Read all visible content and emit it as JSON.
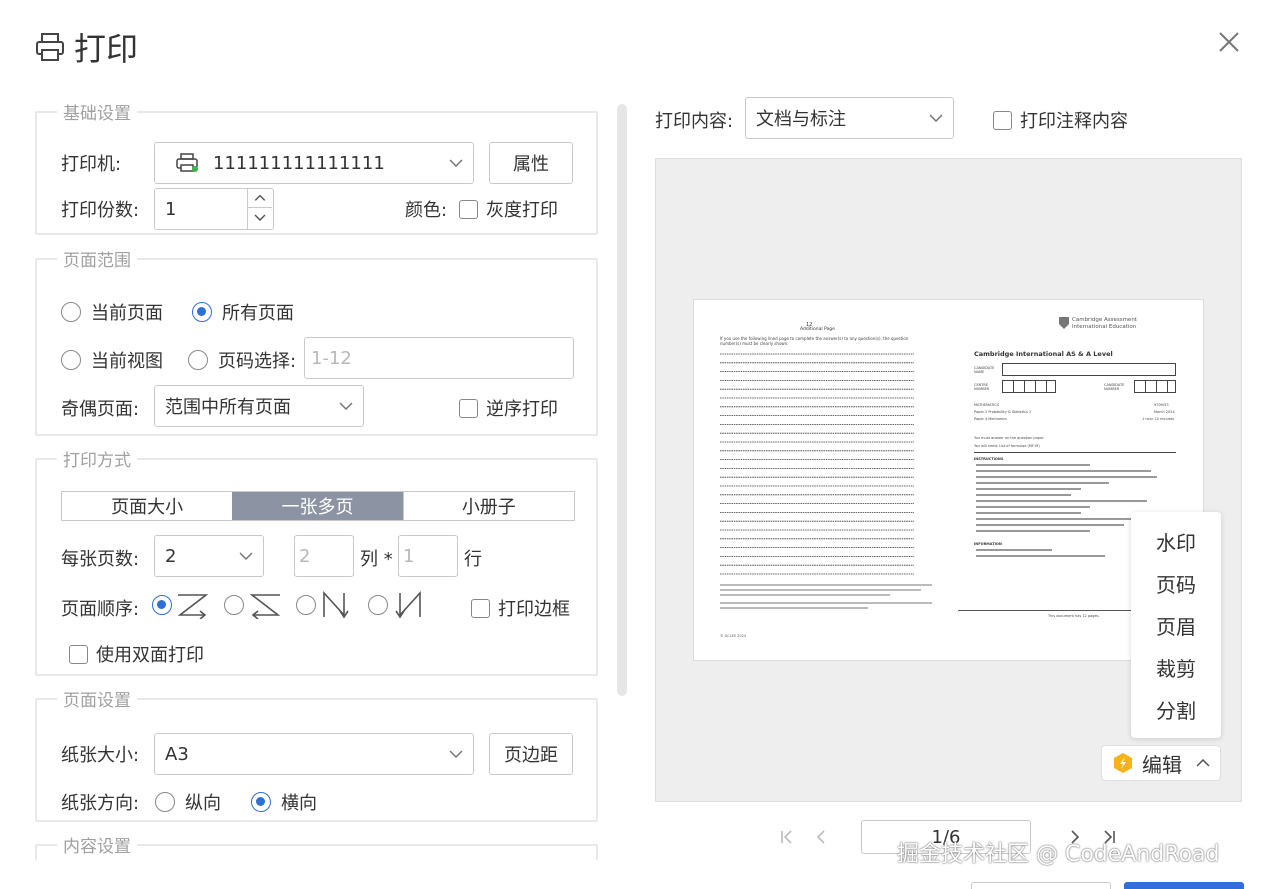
{
  "dialog": {
    "title": "打印"
  },
  "basic": {
    "legend": "基础设置",
    "printer_label": "打印机:",
    "printer_value": "111111111111111",
    "properties_btn": "属性",
    "copies_label": "打印份数:",
    "copies_value": "1",
    "color_label": "颜色:",
    "grayscale_label": "灰度打印"
  },
  "range": {
    "legend": "页面范围",
    "current_page": "当前页面",
    "all_pages": "所有页面",
    "current_view": "当前视图",
    "page_select": "页码选择:",
    "page_select_placeholder": "1-12",
    "odd_even_label": "奇偶页面:",
    "odd_even_value": "范围中所有页面",
    "reverse_label": "逆序打印"
  },
  "mode": {
    "legend": "打印方式",
    "tabs": [
      "页面大小",
      "一张多页",
      "小册子"
    ],
    "active_tab": 1,
    "per_sheet_label": "每张页数:",
    "per_sheet_value": "2",
    "cols_value": "2",
    "cols_unit": "列 *",
    "rows_value": "1",
    "rows_unit": "行",
    "order_label": "页面顺序:",
    "print_border": "打印边框",
    "duplex": "使用双面打印"
  },
  "page_setup": {
    "legend": "页面设置",
    "paper_label": "纸张大小:",
    "paper_value": "A3",
    "margins_btn": "页边距",
    "orientation_label": "纸张方向:",
    "portrait": "纵向",
    "landscape": "横向"
  },
  "content": {
    "legend": "内容设置"
  },
  "right": {
    "content_label": "打印内容:",
    "content_value": "文档与标注",
    "annotations_label": "打印注释内容"
  },
  "preview_page": {
    "left_page_no": "12",
    "left_heading": "Additional Page",
    "left_intro": "If you use the following lined page to complete the answer(s) to any question(s), the question number(s) must be clearly shown.",
    "left_footer": "© UCLES 2024",
    "logo_line1": "Cambridge Assessment",
    "logo_line2": "International Education",
    "right_title": "Cambridge International AS & A Level",
    "candidate_name": "CANDIDATE NAME",
    "centre_number": "CENTRE NUMBER",
    "candidate_number": "CANDIDATE NUMBER",
    "subject": "MATHEMATICS",
    "code": "9709/53",
    "paper": "Paper 5 Probability & Statistics 1",
    "session": "March 2024",
    "paper2": "Paper 4 Mechanics",
    "duration": "1 hour 15 minutes",
    "answer_on": "You must answer on the question paper.",
    "need": "You will need: List of formulae (MF19)",
    "instructions": "INSTRUCTIONS",
    "information": "INFORMATION",
    "doc_count": "This document has 12 pages."
  },
  "edit_menu": {
    "items": [
      "水印",
      "页码",
      "页眉",
      "裁剪",
      "分割"
    ],
    "button": "编辑"
  },
  "pager": {
    "value": "1/6"
  },
  "watermark": "掘金技术社区 @ CodeAndRoad"
}
